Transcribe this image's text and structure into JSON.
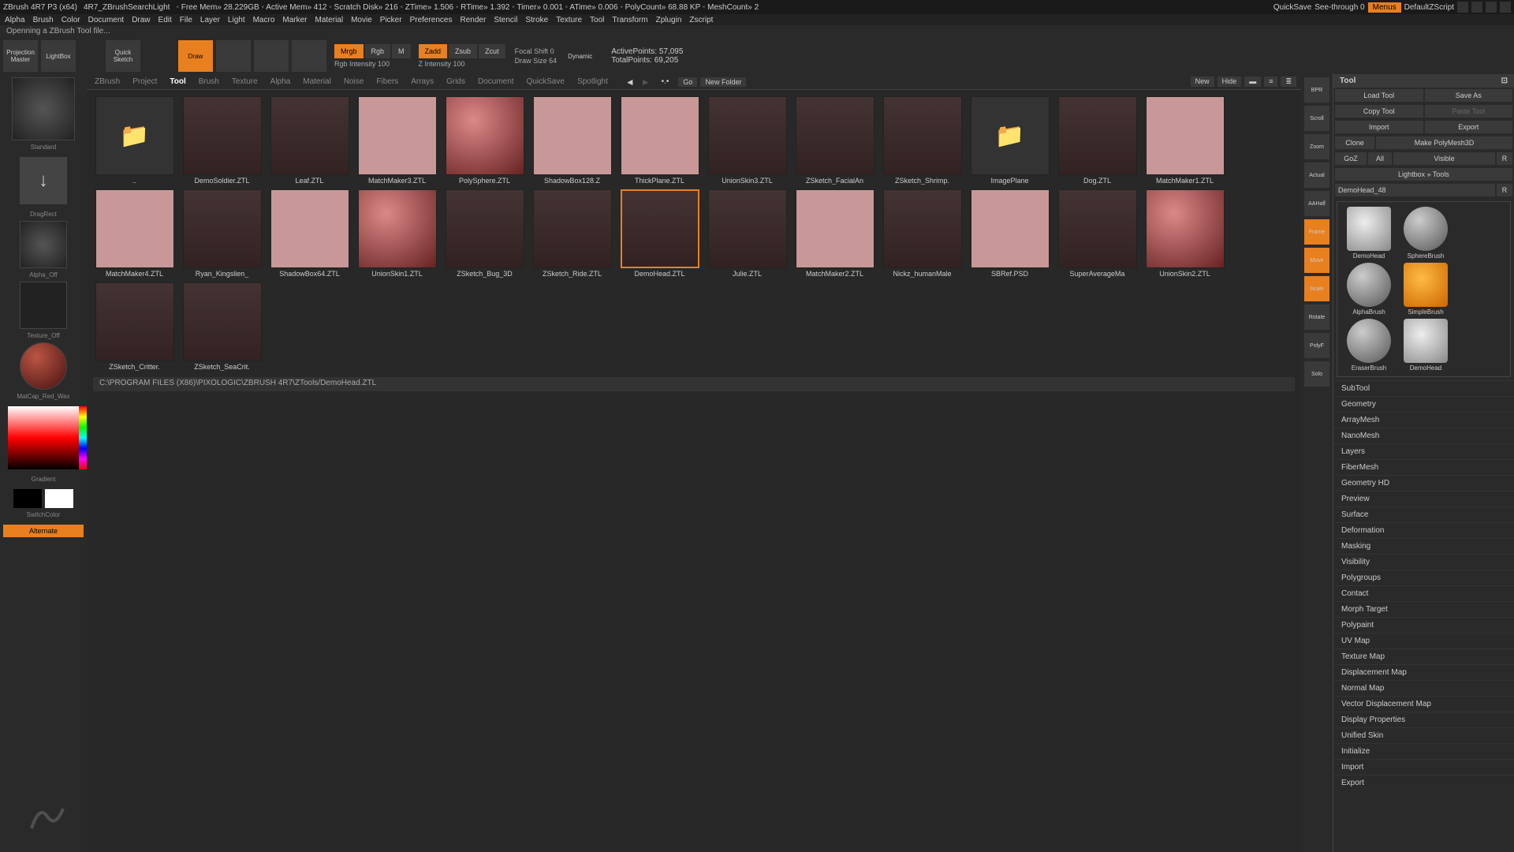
{
  "title": {
    "app": "ZBrush 4R7 P3 (x64)",
    "doc": "4R7_ZBrushSearchLight",
    "stats": [
      "Free Mem» 28.229GB",
      "Active Mem» 412",
      "Scratch Disk» 216",
      "ZTime» 1.506",
      "RTime» 1.392",
      "Timer» 0.001",
      "ATime» 0.006",
      "PolyCount» 68.88 KP",
      "MeshCount» 2"
    ],
    "quicksave": "QuickSave",
    "seethrough": "See-through  0",
    "menus": "Menus",
    "script": "DefaultZScript"
  },
  "menu": [
    "Alpha",
    "Brush",
    "Color",
    "Document",
    "Draw",
    "Edit",
    "File",
    "Layer",
    "Light",
    "Macro",
    "Marker",
    "Material",
    "Movie",
    "Picker",
    "Preferences",
    "Render",
    "Stencil",
    "Stroke",
    "Texture",
    "Tool",
    "Transform",
    "Zplugin",
    "Zscript"
  ],
  "status": "Openning a ZBrush Tool file...",
  "toolbar": {
    "projection": "Projection Master",
    "lightbox": "LightBox",
    "quicksketch": "Quick Sketch",
    "draw": "Draw",
    "modes": {
      "mrgb": "Mrgb",
      "rgb": "Rgb",
      "m": "M",
      "zadd": "Zadd",
      "zsub": "Zsub",
      "zcut": "Zcut"
    },
    "rgb_intensity": "Rgb Intensity 100",
    "z_intensity": "Z Intensity 100",
    "focal": "Focal Shift 0",
    "drawsize": "Draw Size 64",
    "dynamic": "Dynamic",
    "active_pts": "ActivePoints: 57,095",
    "total_pts": "TotalPoints: 69,205"
  },
  "left": {
    "dragrect": "DragRect",
    "alpha_off": "Alpha_Off",
    "texture_off": "Texture_Off",
    "matcap": "MatCap_Red_Wax",
    "gradient": "Gradient",
    "switchcolor": "SwitchColor",
    "alternate": "Alternate"
  },
  "lightbox": {
    "tabs": [
      "ZBrush",
      "Project",
      "Tool",
      "Brush",
      "Texture",
      "Alpha",
      "Material",
      "Noise",
      "Fibers",
      "Arrays",
      "Grids",
      "Document",
      "QuickSave",
      "Spotlight"
    ],
    "active_tab": "Tool",
    "go": "Go",
    "newfolder": "New Folder",
    "new": "New",
    "hide": "Hide",
    "items": [
      {
        "name": "..",
        "type": "folder"
      },
      {
        "name": "DemoSoldier.ZTL",
        "type": "figure"
      },
      {
        "name": "Leaf.ZTL",
        "type": "figure"
      },
      {
        "name": "MatchMaker3.ZTL",
        "type": "plane"
      },
      {
        "name": "PolySphere.ZTL",
        "type": "sphere"
      },
      {
        "name": "ShadowBox128.Z",
        "type": "plane"
      },
      {
        "name": "ThickPlane.ZTL",
        "type": "plane"
      },
      {
        "name": "UnionSkin3.ZTL",
        "type": "figure"
      },
      {
        "name": "ZSketch_FacialAn",
        "type": "figure"
      },
      {
        "name": "ZSketch_Shrimp.",
        "type": "figure"
      },
      {
        "name": "ImagePlane",
        "type": "folder"
      },
      {
        "name": "Dog.ZTL",
        "type": "figure"
      },
      {
        "name": "MatchMaker1.ZTL",
        "type": "plane"
      },
      {
        "name": "MatchMaker4.ZTL",
        "type": "plane"
      },
      {
        "name": "Ryan_Kingslien_",
        "type": "figure"
      },
      {
        "name": "ShadowBox64.ZTL",
        "type": "plane"
      },
      {
        "name": "UnionSkin1.ZTL",
        "type": "sphere"
      },
      {
        "name": "ZSketch_Bug_3D",
        "type": "figure"
      },
      {
        "name": "ZSketch_Ride.ZTL",
        "type": "figure"
      },
      {
        "name": "DemoHead.ZTL",
        "type": "figure",
        "selected": true
      },
      {
        "name": "Julie.ZTL",
        "type": "figure"
      },
      {
        "name": "MatchMaker2.ZTL",
        "type": "plane"
      },
      {
        "name": "Nickz_humanMale",
        "type": "figure"
      },
      {
        "name": "SBRef.PSD",
        "type": "plane"
      },
      {
        "name": "SuperAverageMa",
        "type": "figure"
      },
      {
        "name": "UnionSkin2.ZTL",
        "type": "sphere"
      },
      {
        "name": "ZSketch_Critter.",
        "type": "figure"
      },
      {
        "name": "ZSketch_SeaCrit.",
        "type": "figure"
      }
    ],
    "path": "C:\\PROGRAM FILES (X86)\\PIXOLOGIC\\ZBRUSH 4R7\\ZTools/DemoHead.ZTL"
  },
  "rstrip": [
    "BPR",
    "Scroll",
    "Zoom",
    "Actual",
    "AAHalf",
    "Frame",
    "Move",
    "Scale",
    "Rotate",
    "PolyF",
    "Solo"
  ],
  "tool": {
    "title": "Tool",
    "buttons": {
      "load": "Load Tool",
      "save": "Save As",
      "copy": "Copy Tool",
      "paste": "Paste Tool",
      "import": "Import",
      "export": "Export",
      "clone": "Clone",
      "makepm": "Make PolyMesh3D",
      "goz": "GoZ",
      "all": "All",
      "visible": "Visible",
      "r": "R",
      "lbtools": "Lightbox » Tools"
    },
    "current": "DemoHead_48",
    "thumbs": [
      "DemoHead",
      "SphereBrush",
      "AlphaBrush",
      "SimpleBrush",
      "EraserBrush",
      "DemoHead"
    ],
    "sections": [
      "SubTool",
      "Geometry",
      "ArrayMesh",
      "NanoMesh",
      "Layers",
      "FiberMesh",
      "Geometry HD",
      "Preview",
      "Surface",
      "Deformation",
      "Masking",
      "Visibility",
      "Polygroups",
      "Contact",
      "Morph Target",
      "Polypaint",
      "UV Map",
      "Texture Map",
      "Displacement Map",
      "Normal Map",
      "Vector Displacement Map",
      "Display Properties",
      "Unified Skin",
      "Initialize",
      "Import",
      "Export"
    ]
  }
}
